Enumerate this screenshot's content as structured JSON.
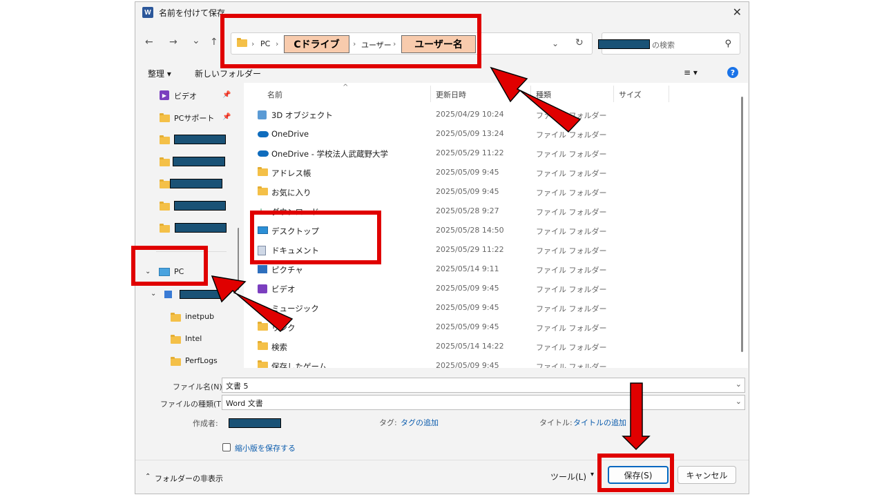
{
  "title": "名前を付けて保存",
  "app_icon": "W",
  "nav": {
    "back": "←",
    "forward": "→",
    "recent": "⌄",
    "up": "↑"
  },
  "breadcrumb": {
    "sep": "›",
    "pc": "PC",
    "drive": "Cドライブ",
    "users": "ユーザー",
    "username": "ユーザー名"
  },
  "search": {
    "placeholder": "の検索"
  },
  "toolbar": {
    "organize": "整理 ▾",
    "new_folder": "新しいフォルダー",
    "view": "≡ ▾",
    "help": "?"
  },
  "sidebar": {
    "items": [
      {
        "label": "ビデオ"
      },
      {
        "label": "PCサポート"
      },
      {
        "label": ""
      },
      {
        "label": ""
      },
      {
        "label": ""
      },
      {
        "label": ""
      },
      {
        "label": ""
      }
    ],
    "pc": "PC",
    "drive_children": [
      "inetpub",
      "Intel",
      "PerfLogs"
    ]
  },
  "columns": {
    "name": "名前",
    "date": "更新日時",
    "type": "種類",
    "size": "サイズ"
  },
  "files": [
    {
      "name": "3D オブジェクト",
      "date": "2025/04/29 10:24",
      "type": "ファイル フォルダー",
      "icon": "cube-icon"
    },
    {
      "name": "OneDrive",
      "date": "2025/05/09 13:24",
      "type": "ファイル フォルダー",
      "icon": "cloud-icon"
    },
    {
      "name": "OneDrive - 学校法人武蔵野大学",
      "date": "2025/05/29 11:22",
      "type": "ファイル フォルダー",
      "icon": "cloud-icon"
    },
    {
      "name": "アドレス帳",
      "date": "2025/05/09 9:45",
      "type": "ファイル フォルダー",
      "icon": "folder-icon"
    },
    {
      "name": "お気に入り",
      "date": "2025/05/09 9:45",
      "type": "ファイル フォルダー",
      "icon": "folder-icon"
    },
    {
      "name": "ダウンロード",
      "date": "2025/05/28 9:27",
      "type": "ファイル フォルダー",
      "icon": "download-icon"
    },
    {
      "name": "デスクトップ",
      "date": "2025/05/28 14:50",
      "type": "ファイル フォルダー",
      "icon": "desktop-icon"
    },
    {
      "name": "ドキュメント",
      "date": "2025/05/29 11:22",
      "type": "ファイル フォルダー",
      "icon": "document-icon"
    },
    {
      "name": "ピクチャ",
      "date": "2025/05/14 9:11",
      "type": "ファイル フォルダー",
      "icon": "picture-icon"
    },
    {
      "name": "ビデオ",
      "date": "2025/05/09 9:45",
      "type": "ファイル フォルダー",
      "icon": "video-icon"
    },
    {
      "name": "ミュージック",
      "date": "2025/05/09 9:45",
      "type": "ファイル フォルダー",
      "icon": "music-icon"
    },
    {
      "name": "リンク",
      "date": "2025/05/09 9:45",
      "type": "ファイル フォルダー",
      "icon": "folder-icon"
    },
    {
      "name": "検索",
      "date": "2025/05/14 14:22",
      "type": "ファイル フォルダー",
      "icon": "folder-icon"
    },
    {
      "name": "保存したゲーム",
      "date": "2025/05/09 9:45",
      "type": "ファイル フォルダー",
      "icon": "folder-icon"
    }
  ],
  "form": {
    "filename_label": "ファイル名(N):",
    "filename_value": "文書 5",
    "filetype_label": "ファイルの種類(T):",
    "filetype_value": "Word 文書",
    "author_label": "作成者:",
    "tags_label": "タグ:",
    "tags_link": "タグの追加",
    "title_label": "タイトル:",
    "title_link": "タイトルの追加",
    "thumbnail_label": "縮小版を保存する"
  },
  "footer": {
    "hide_folders": "フォルダーの非表示",
    "tools": "ツール(L)",
    "save": "保存(S)",
    "cancel": "キャンセル"
  },
  "colors": {
    "highlight_red": "#e00000",
    "crumb_fill": "#f8cbad",
    "redact": "#1a5276"
  }
}
